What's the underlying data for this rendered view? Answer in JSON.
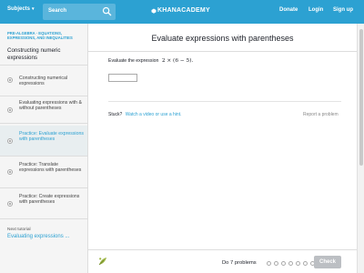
{
  "header": {
    "subjects_label": "Subjects",
    "search_placeholder": "Search",
    "logo_text": "KHANACADEMY",
    "donate": "Donate",
    "login": "Login",
    "signup": "Sign up",
    "bar_color": "#2ca1d2"
  },
  "sidebar": {
    "breadcrumb": "PRE-ALGEBRA · EQUATIONS, EXPRESSIONS, AND INEQUALITIES",
    "tutorial_title": "Constructing numeric expressions",
    "items": [
      {
        "label": "Constructing numerical expressions"
      },
      {
        "label": "Evaluating expressions with & without parentheses"
      },
      {
        "label": "Practice: Evaluate expressions with parentheses",
        "active": true
      },
      {
        "label": "Practice: Translate expressions with parentheses"
      },
      {
        "label": "Practice: Create expressions with parentheses"
      }
    ],
    "next_label": "Next tutorial",
    "next_link": "Evaluating expressions ..."
  },
  "exercise": {
    "title": "Evaluate expressions with parentheses",
    "prompt": "Evaluate the expression",
    "expression": "2 × (6 − 5).",
    "answer_value": "",
    "stuck_label": "Stuck?",
    "help_link": "Watch a video or use a hint.",
    "report": "Report a problem"
  },
  "footer": {
    "goal": "Do 7 problems",
    "progress_total": 7,
    "progress_done": 0,
    "check_label": "Check"
  },
  "colors": {
    "accent": "#2ca1d2",
    "check_disabled": "#bcbfc3",
    "leaf_green": "#9cb443"
  }
}
